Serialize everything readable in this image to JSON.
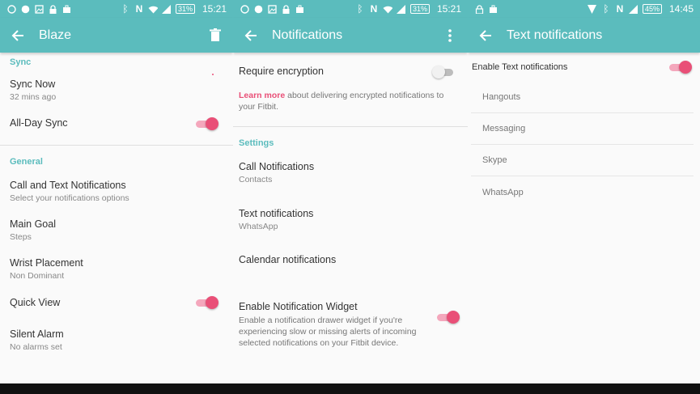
{
  "panel1": {
    "status": {
      "battery": "31%",
      "time": "15:21"
    },
    "appbar": {
      "title": "Blaze",
      "back_icon": "arrow-left-icon",
      "action_icon": "trash-icon"
    },
    "sync_section": "Sync",
    "sync_now": {
      "title": "Sync Now",
      "subtitle": "32 mins ago"
    },
    "all_day_sync": {
      "title": "All-Day Sync",
      "toggle": "on"
    },
    "general_section": "General",
    "call_text": {
      "title": "Call and Text Notifications",
      "subtitle": "Select your notifications options"
    },
    "main_goal": {
      "title": "Main Goal",
      "subtitle": "Steps"
    },
    "wrist": {
      "title": "Wrist Placement",
      "subtitle": "Non Dominant"
    },
    "quick_view": {
      "title": "Quick View",
      "toggle": "on"
    },
    "silent_alarm": {
      "title": "Silent Alarm",
      "subtitle": "No alarms set"
    }
  },
  "panel2": {
    "status": {
      "battery": "31%",
      "time": "15:21"
    },
    "appbar": {
      "title": "Notifications",
      "back_icon": "arrow-left-icon",
      "action_icon": "more-vert-icon"
    },
    "encryption": {
      "title": "Require encryption",
      "toggle": "off",
      "learn_more": "Learn more",
      "desc": " about delivering encrypted notifications to your Fitbit."
    },
    "settings_section": "Settings",
    "call": {
      "title": "Call Notifications",
      "subtitle": "Contacts"
    },
    "text": {
      "title": "Text notifications",
      "subtitle": "WhatsApp"
    },
    "calendar": {
      "title": "Calendar notifications"
    },
    "widget": {
      "title": "Enable Notification Widget",
      "subtitle": "Enable a notification drawer widget if you're experiencing slow or missing alerts of incoming selected notifications on your Fitbit device.",
      "toggle": "on"
    }
  },
  "panel3": {
    "status": {
      "battery": "45%",
      "time": "14:45"
    },
    "appbar": {
      "title": "Text notifications",
      "back_icon": "arrow-left-icon"
    },
    "enable": {
      "title": "Enable Text notifications",
      "toggle": "on"
    },
    "apps": [
      "Hangouts",
      "Messaging",
      "Skype",
      "WhatsApp"
    ]
  },
  "colors": {
    "accent": "#5bbcbd",
    "toggle_on": "#e94f77",
    "link": "#e94f77"
  }
}
